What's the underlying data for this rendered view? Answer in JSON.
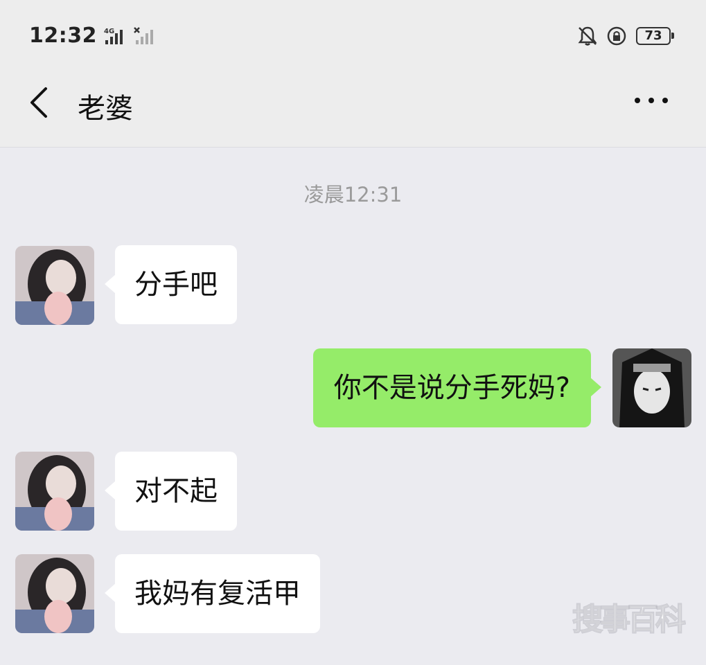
{
  "status_bar": {
    "time": "12:32",
    "network": "4G",
    "battery": "73",
    "icons": [
      "signal-4g-icon",
      "signal-no-service-icon",
      "bell-muted-icon",
      "rotation-lock-icon",
      "battery-icon"
    ]
  },
  "header": {
    "title": "老婆",
    "back_icon": "chevron-left-icon",
    "more_icon": "more-horizontal-icon"
  },
  "chat": {
    "timestamp": "凌晨12:31",
    "messages": [
      {
        "sender": "contact",
        "text": "分手吧"
      },
      {
        "sender": "me",
        "text": "你不是说分手死妈?"
      },
      {
        "sender": "contact",
        "text": "对不起"
      },
      {
        "sender": "contact",
        "text": "我妈有复活甲"
      }
    ]
  },
  "watermark": "搜事百科",
  "colors": {
    "background": "#ebebf0",
    "header": "#ededed",
    "bubble_incoming": "#ffffff",
    "bubble_outgoing": "#95ec69",
    "timestamp": "#9a9a9a"
  }
}
